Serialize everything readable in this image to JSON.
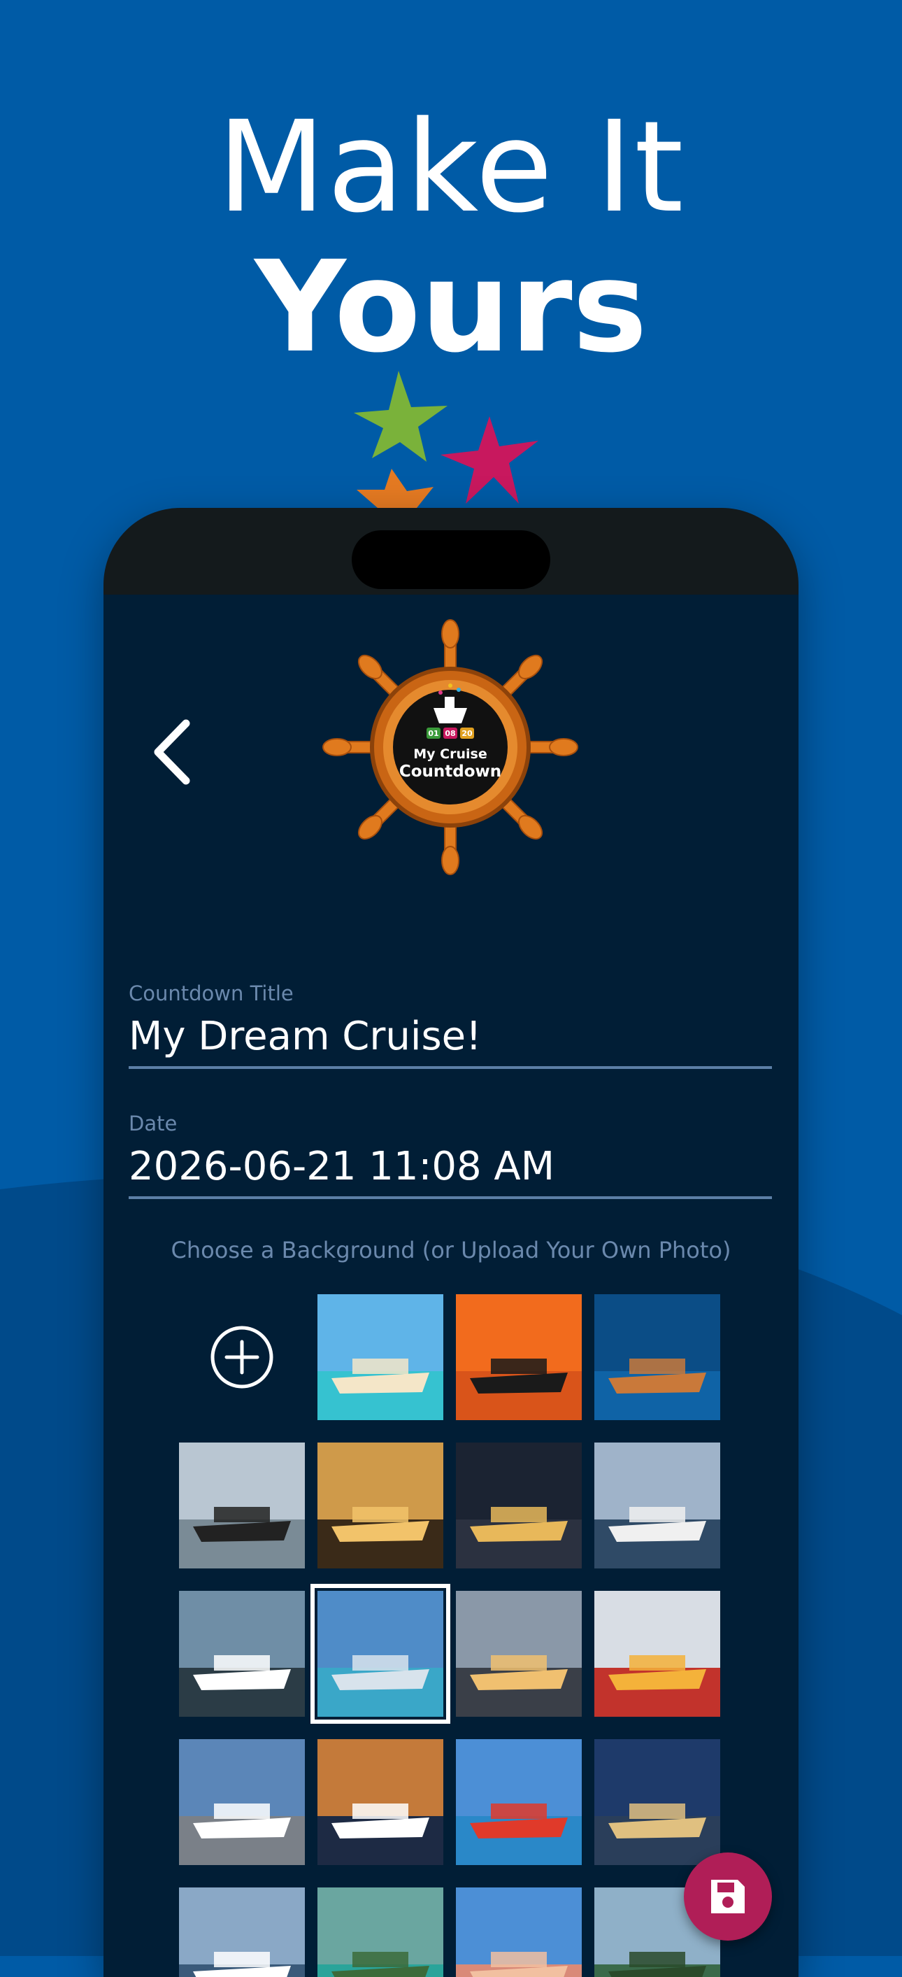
{
  "headline": {
    "line1": "Make It",
    "line2": "Yours"
  },
  "logo": {
    "badges": [
      "01",
      "08",
      "20"
    ],
    "text_line1": "My Cruise",
    "text_line2": "Countdown"
  },
  "form": {
    "title_label": "Countdown Title",
    "title_value": "My Dream Cruise!",
    "date_label": "Date",
    "date_value": "2026-06-21 11:08 AM"
  },
  "background_chooser": {
    "label": "Choose a Background (or Upload Your Own Photo)",
    "selected_index": 8,
    "thumbnails": [
      {
        "name": "beach-ship-photo",
        "sky": "#5fb4e8",
        "water": "#36c2d0",
        "accent": "#f4e6c8"
      },
      {
        "name": "sunset-ship-photo",
        "sky": "#f26b1d",
        "water": "#d9541a",
        "accent": "#1a1a1a"
      },
      {
        "name": "aerial-wake-photo",
        "sky": "#0b4d86",
        "water": "#0f63a6",
        "accent": "#c9793a"
      },
      {
        "name": "steamboat-mountains-photo",
        "sky": "#b9c6d2",
        "water": "#7a8b96",
        "accent": "#222222"
      },
      {
        "name": "ship-stern-dusk-photo",
        "sky": "#cf9a4a",
        "water": "#3a2a18",
        "accent": "#f2c36a"
      },
      {
        "name": "ship-night-lights-photo",
        "sky": "#1b2332",
        "water": "#2b3140",
        "accent": "#e8b85a"
      },
      {
        "name": "white-ship-harbor-photo",
        "sky": "#9fb3c9",
        "water": "#2f4a66",
        "accent": "#f0f0f0"
      },
      {
        "name": "ship-open-sea-photo",
        "sky": "#6f8ea6",
        "water": "#2b3c46",
        "accent": "#ffffff"
      },
      {
        "name": "city-skyline-deck-photo",
        "sky": "#4f8cc8",
        "water": "#3aa7c8",
        "accent": "#d8e3ec"
      },
      {
        "name": "ship-twilight-port-photo",
        "sky": "#8a98a8",
        "water": "#3a3f48",
        "accent": "#f0c070"
      },
      {
        "name": "colorful-deck-art-photo",
        "sky": "#d8dde4",
        "water": "#c2332c",
        "accent": "#f4b23a"
      },
      {
        "name": "ship-pier-photo",
        "sky": "#5b86b8",
        "water": "#7a8088",
        "accent": "#ffffff"
      },
      {
        "name": "ship-dramatic-sky-photo",
        "sky": "#c47a3a",
        "water": "#1d2a44",
        "accent": "#ffffff"
      },
      {
        "name": "carnival-funnel-photo",
        "sky": "#4c8fd6",
        "water": "#2a88c8",
        "accent": "#e03a2a"
      },
      {
        "name": "ship-evening-photo",
        "sky": "#1e3a6a",
        "water": "#2a3e5a",
        "accent": "#e0c080"
      },
      {
        "name": "ship-partial-photo",
        "sky": "#8aa8c6",
        "water": "#3a5a7a",
        "accent": "#ffffff"
      },
      {
        "name": "lagoon-trees-photo",
        "sky": "#6aa6a0",
        "water": "#2aa49a",
        "accent": "#3b6b3a"
      },
      {
        "name": "pink-resort-photo",
        "sky": "#4c8fd6",
        "water": "#d98a78",
        "accent": "#f2c0a0"
      },
      {
        "name": "island-peak-photo",
        "sky": "#8fb0c8",
        "water": "#3a6a4a",
        "accent": "#2a4a2a"
      }
    ]
  },
  "colors": {
    "background": "#005ba6",
    "screen": "#011e36",
    "label": "#6b89ad",
    "accent": "#b01e57",
    "star_green": "#7ab23a",
    "star_magenta": "#c8185e",
    "star_orange": "#e57a22"
  },
  "icons": {
    "back": "chevron-left-icon",
    "add": "plus-circle-icon",
    "save": "floppy-disk-icon"
  }
}
